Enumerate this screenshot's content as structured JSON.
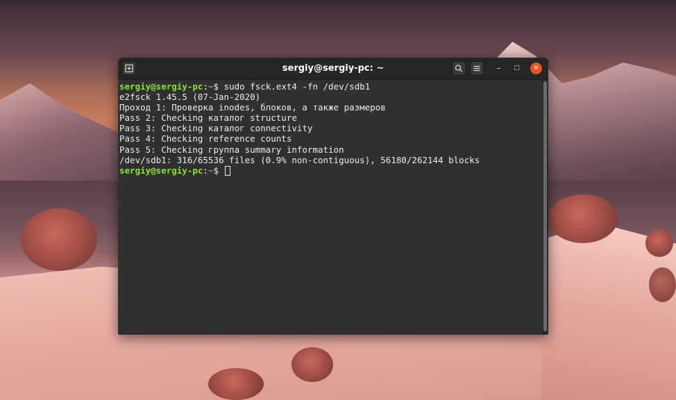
{
  "window": {
    "title": "sergiy@sergiy-pc: ~",
    "icons": {
      "new_tab": "new-tab-icon",
      "search": "search-icon",
      "menu": "hamburger-menu-icon",
      "minimize": "minimize-icon",
      "maximize": "maximize-icon",
      "close": "close-icon"
    },
    "controls": {
      "minimize": "–",
      "maximize": "□",
      "close": "✕"
    },
    "close_color": "#e95420"
  },
  "terminal": {
    "prompt": {
      "user_host": "sergiy@sergiy-pc",
      "separator": ":",
      "path": "~",
      "symbol": "$ "
    },
    "command": "sudo fsck.ext4 -fn /dev/sdb1",
    "output": [
      "e2fsck 1.45.5 (07-Jan-2020)",
      "Проход 1: Проверка inodes, блоков, а также размеров",
      "Pass 2: Checking каталог structure",
      "Pass 3: Checking каталог connectivity",
      "Pass 4: Checking reference counts",
      "Pass 5: Checking группа summary information",
      "/dev/sdb1: 316/65536 files (0.9% non-contiguous), 56180/262144 blocks"
    ],
    "colors": {
      "user": "#8ae234",
      "path": "#729fcf",
      "text": "#ececec",
      "background": "#303030"
    }
  }
}
